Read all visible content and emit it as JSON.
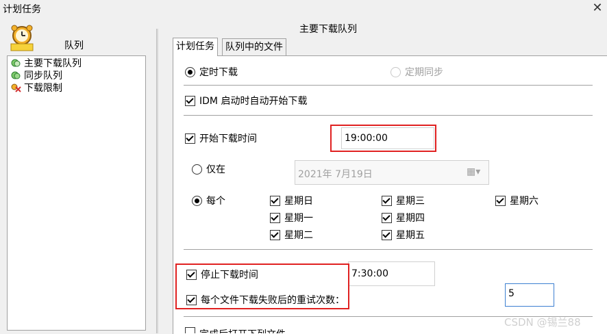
{
  "window": {
    "title": "计划任务"
  },
  "left": {
    "header": "队列",
    "items": [
      {
        "label": "主要下载队列",
        "icon": "queue-icon"
      },
      {
        "label": "同步队列",
        "icon": "sync-queue-icon"
      },
      {
        "label": "下载限制",
        "icon": "limit-icon"
      }
    ]
  },
  "right": {
    "title": "主要下载队列",
    "tabs": [
      "计划任务",
      "队列中的文件"
    ],
    "mode": {
      "scheduled": "定时下载",
      "periodic": "定期同步"
    },
    "idm_autostart": "IDM 启动时自动开始下载",
    "start_time": {
      "label": "开始下载时间",
      "value": "19:00:00"
    },
    "once": {
      "label": "仅在",
      "date": "2021年  7月19日"
    },
    "every": {
      "label": "每个",
      "days": [
        "星期日",
        "星期一",
        "星期二",
        "星期三",
        "星期四",
        "星期五",
        "星期六"
      ]
    },
    "stop_time": {
      "label": "停止下载时间",
      "value": "7:30:00"
    },
    "retry": {
      "label": "每个文件下载失败后的重试次数：",
      "value": "5"
    },
    "partial_next": "完成后打开下列文件"
  },
  "watermark": "CSDN @锡兰88",
  "colors": {
    "highlight": "#e02020",
    "border": "#a0a0a0"
  }
}
